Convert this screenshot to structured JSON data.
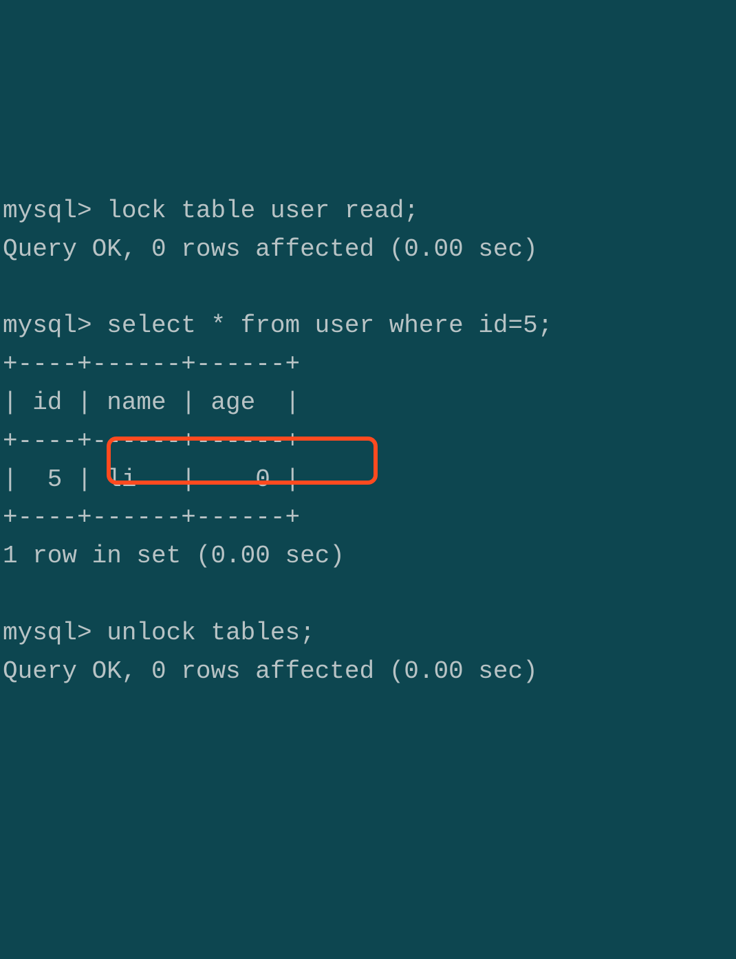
{
  "terminal": {
    "prompt": "mysql>",
    "cmd1": "lock table user read;",
    "resp1": "Query OK, 0 rows affected (0.00 sec)",
    "blank": "",
    "cmd2": "select * from user where id=5;",
    "table_border": "+----+------+------+",
    "table_header": "| id | name | age  |",
    "table_row": "|  5 | li   |    0 |",
    "resp2": "1 row in set (0.00 sec)",
    "cmd3": "unlock tables;",
    "resp3": "Query OK, 0 rows affected (0.00 sec)"
  },
  "chart_data": {
    "type": "table",
    "columns": [
      "id",
      "name",
      "age"
    ],
    "rows": [
      {
        "id": 5,
        "name": "li",
        "age": 0
      }
    ],
    "row_count_text": "1 row in set (0.00 sec)"
  },
  "highlight": {
    "target": "unlock tables;"
  }
}
